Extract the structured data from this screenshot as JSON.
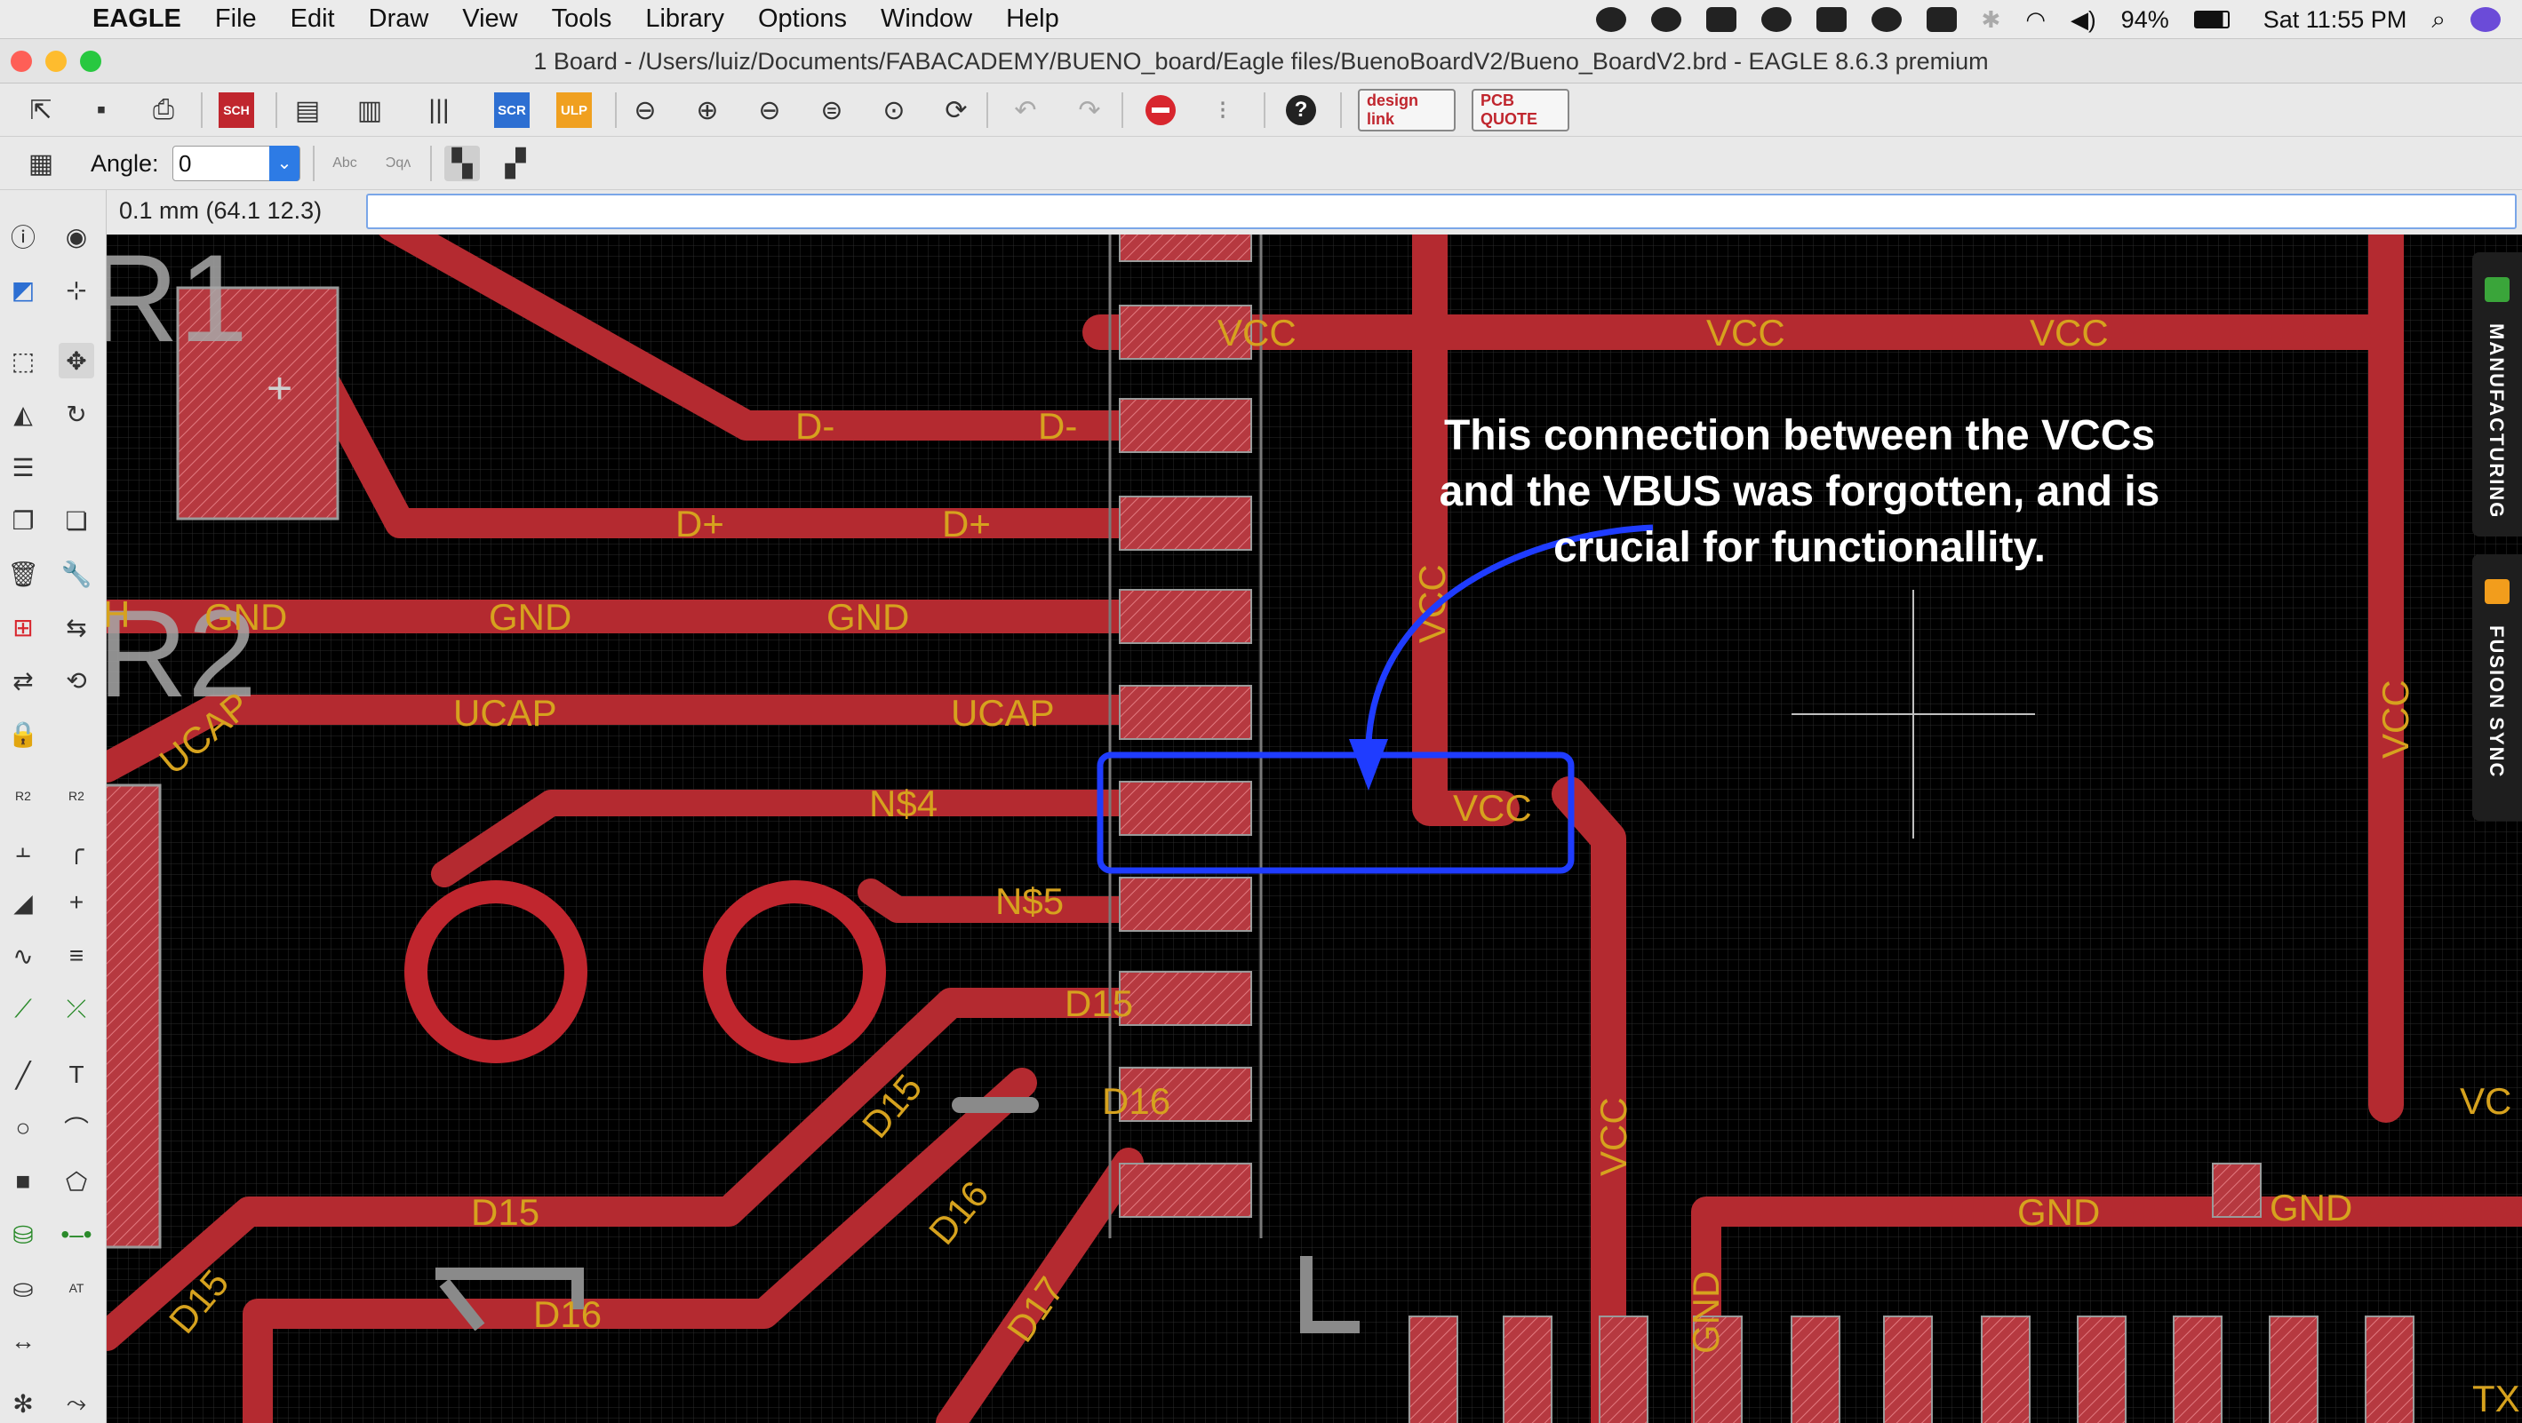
{
  "menubar": {
    "app_name": "EAGLE",
    "items": [
      "File",
      "Edit",
      "Draw",
      "View",
      "Tools",
      "Library",
      "Options",
      "Window",
      "Help"
    ],
    "battery": "94%",
    "clock": "Sat 11:55 PM"
  },
  "window": {
    "title": "1 Board - /Users/luiz/Documents/FABACADEMY/BUENO_board/Eagle files/BuenoBoardV2/Bueno_BoardV2.brd - EAGLE 8.6.3 premium"
  },
  "toolbar": {
    "design_link_label": "design link",
    "pcb_quote_label": "PCB QUOTE",
    "angle_label": "Angle:",
    "angle_value": "0"
  },
  "command_bar": {
    "coordinates": "0.1 mm (64.1 12.3)",
    "command_value": ""
  },
  "side_tabs": {
    "manufacturing": "MANUFACTURING",
    "fusion_sync": "FUSION SYNC"
  },
  "board": {
    "component_labels": [
      "R1",
      "R2",
      "+"
    ],
    "trace_labels": {
      "vcc": "VCC",
      "d_minus": "D-",
      "d_plus": "D+",
      "gnd": "GND",
      "ucap": "UCAP",
      "ns4": "N$4",
      "ns5": "N$5",
      "d15": "D15",
      "d16": "D16",
      "d17": "D17",
      "vc_cut": "VC",
      "tx_cut": "TX",
      "h": "H"
    }
  },
  "annotation": {
    "line1": "This connection between the VCCs",
    "line2": "and the VBUS was forgotten, and is",
    "line3": "crucial for functionallity."
  },
  "colors": {
    "trace": "#b42a30",
    "pad": "#c8434a",
    "label": "#d6a21e",
    "annotation": "#1f3cff",
    "canvas": "#000000"
  }
}
